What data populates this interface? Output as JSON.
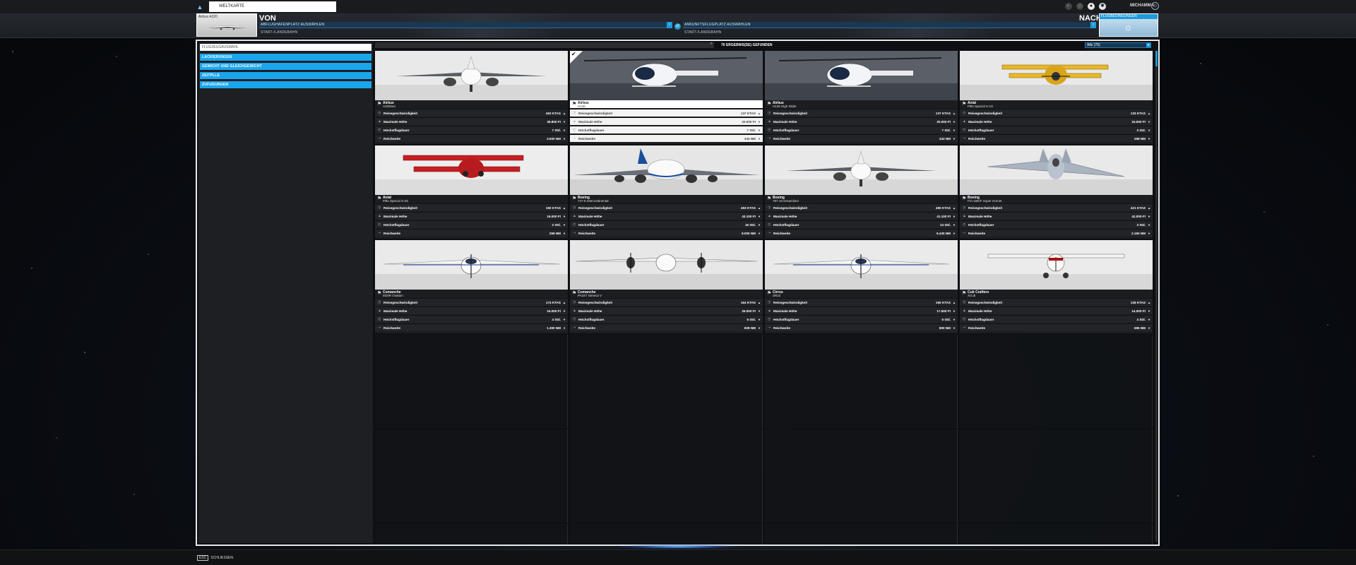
{
  "topbar": {
    "breadcrumb": "WELTKARTE",
    "username": "MICHAMMA"
  },
  "flight": {
    "aircraft_thumb_label": "Airbus A320",
    "from_label": "VON",
    "to_label": "NACH",
    "from_airport": "ABFLUGHAFENPLATZ AUSWÄHLEN",
    "from_runway": "START-/LANDEBAHN",
    "to_airport": "ANKUNFTSFLUGPLATZ AUSWÄHLEN",
    "to_runway": "START-/LANDEBAHN",
    "weather_label": "FLUGBEDINGUNGEN"
  },
  "filters": {
    "search_placeholder": "FLUGZEUGAUSWAHL",
    "items": [
      "LACKIERUNGEN",
      "GEWICHT UND GLEICHGEWICHT",
      "ZEITPLLE",
      "ZUFUGUNGEN"
    ]
  },
  "results": {
    "count_label": "76 ERGEBNIS(SE) GEFUNDEN",
    "sort_label": "Alle (76)"
  },
  "stat_labels": [
    "Reisegeschwindigkeit",
    "Maximale Höhe",
    "Höchstflugdauer",
    "Reichweite"
  ],
  "aircraft": [
    {
      "maker": "Airbus",
      "model": "A320neo",
      "stats": [
        "463 KTAS",
        "39.800 Ft",
        "7 Std.",
        "3.500 NM"
      ],
      "icon": "jet"
    },
    {
      "maker": "Airbus",
      "model": "H135",
      "stats": [
        "137 KTAS",
        "20.000 Ft",
        "7 Std.",
        "343 NM"
      ],
      "icon": "heli",
      "selected": true
    },
    {
      "maker": "Airbus",
      "model": "H135 High Skids",
      "stats": [
        "137 KTAS",
        "20.000 Ft",
        "7 Std.",
        "343 NM"
      ],
      "icon": "heli"
    },
    {
      "maker": "Aviat",
      "model": "Pitts Special S-1S",
      "stats": [
        "133 KTAS",
        "15.000 Ft",
        "3 Std.",
        "298 NM"
      ],
      "icon": "biplane-yellow"
    },
    {
      "maker": "Aviat",
      "model": "Pitts Special S-2S",
      "stats": [
        "150 KTAS",
        "16.000 Ft",
        "2 Std.",
        "258 NM"
      ],
      "icon": "biplane-red"
    },
    {
      "maker": "Boeing",
      "model": "747-8 Intercontinental",
      "stats": [
        "493 KTAS",
        "43.100 Ft",
        "16 Std.",
        "8.000 NM"
      ],
      "icon": "jumbo"
    },
    {
      "maker": "Boeing",
      "model": "787-10 Dreamliner",
      "stats": [
        "490 KTAS",
        "41.100 Ft",
        "13 Std.",
        "6.430 NM"
      ],
      "icon": "jet"
    },
    {
      "maker": "Boeing",
      "model": "F/A-18E/F Super Hornet",
      "stats": [
        "421 KTAS",
        "42.000 Ft",
        "3 Std.",
        "2.160 NM"
      ],
      "icon": "fighter"
    },
    {
      "maker": "Comanche",
      "model": "M20R Ovation",
      "stats": [
        "174 KTAS",
        "15.000 Ft",
        "4 Std.",
        "1.300 NM"
      ],
      "icon": "prop"
    },
    {
      "maker": "Comanche",
      "model": "PA34T Seneca V",
      "stats": [
        "164 KTAS",
        "25.000 Ft",
        "6 Std.",
        "828 NM"
      ],
      "icon": "twin"
    },
    {
      "maker": "Cirrus",
      "model": "SR22",
      "stats": [
        "150 KTAS",
        "17.500 Ft",
        "5 Std.",
        "800 NM"
      ],
      "icon": "prop"
    },
    {
      "maker": "Cub Crafters",
      "model": "XCub",
      "stats": [
        "128 KTAS",
        "14.000 Ft",
        "4 Std.",
        "695 NM"
      ],
      "icon": "highwing"
    }
  ],
  "bottom": {
    "close_key": "ESC",
    "close_label": "SCHLIESSEN"
  }
}
